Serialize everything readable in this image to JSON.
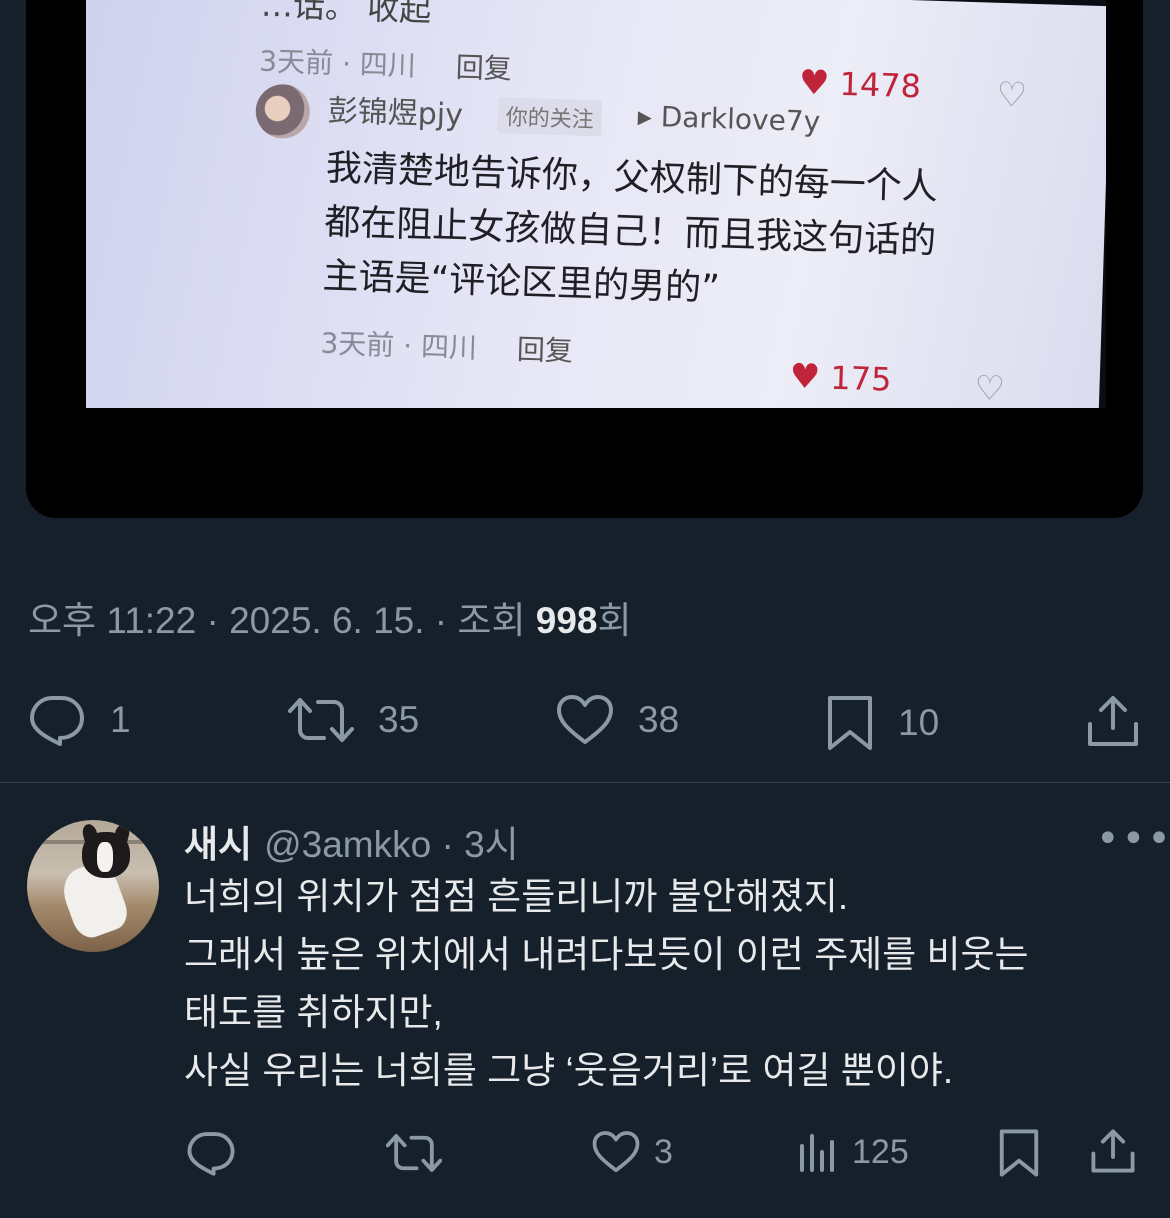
{
  "media": {
    "top_fragment": "…话。 收起",
    "comment1": {
      "meta_time": "3天前 · 四川",
      "reply": "回复",
      "likes": "1478"
    },
    "comment2": {
      "name": "彭锦煜pjy",
      "tag": "你的关注",
      "reply_to": "▸ Darklove7y",
      "body_lines": [
        "我清楚地告诉你，父权制下的每一个人",
        "都在阻止女孩做自己！而且我这句话的",
        "主语是“评论区里的男的”"
      ],
      "meta_time": "3天前 · 四川",
      "reply": "回复",
      "likes": "175"
    }
  },
  "tweet": {
    "timestamp": "오후 11:22 · 2025. 6. 15. · 조회 ",
    "views": "998",
    "views_suffix": "회",
    "actions": {
      "replies": "1",
      "retweets": "35",
      "likes": "38",
      "bookmarks": "10"
    }
  },
  "reply": {
    "name": "새시",
    "handle": "@3amkko · 3시",
    "lines": [
      "너희의 위치가 점점 흔들리니까 불안해졌지.",
      "그래서 높은 위치에서 내려다보듯이 이런 주제를 비웃는",
      "태도를 취하지만,",
      "사실 우리는 너희를 그냥 ‘웃음거리’로 여길 뿐이야."
    ],
    "actions": {
      "likes": "3",
      "views": "125"
    }
  },
  "icons": [
    "heart-icon",
    "broken-heart-icon",
    "reply-icon",
    "retweet-icon",
    "like-icon",
    "bookmark-icon",
    "share-icon",
    "views-icon",
    "more-icon"
  ],
  "colors": {
    "background": "#15202b",
    "text": "#e7e9ea",
    "muted": "#8b98a5",
    "divider": "#38444d"
  }
}
